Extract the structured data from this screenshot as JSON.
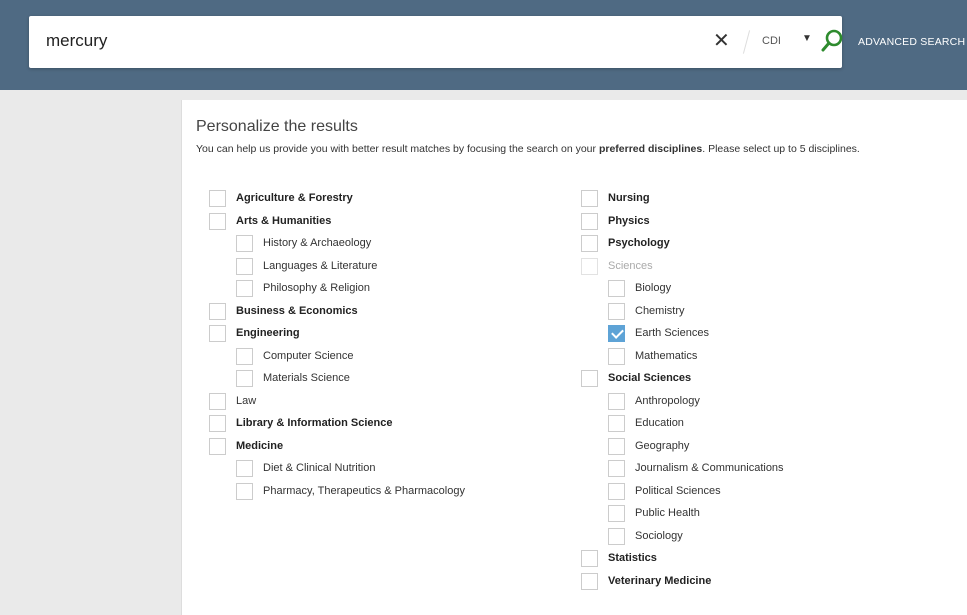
{
  "search": {
    "query": "mercury",
    "scope": "CDI",
    "advanced_label": "ADVANCED SEARCH"
  },
  "panel": {
    "title": "Personalize the results",
    "desc_before": "You can help us provide you with better result matches by focusing the search on your ",
    "desc_bold": "preferred disciplines",
    "desc_after": ". Please select up to 5 disciplines."
  },
  "left_disciplines": [
    {
      "label": "Agriculture & Forestry",
      "level": "parent",
      "checked": false
    },
    {
      "label": "Arts & Humanities",
      "level": "parent",
      "checked": false
    },
    {
      "label": "History & Archaeology",
      "level": "child",
      "checked": false
    },
    {
      "label": "Languages & Literature",
      "level": "child",
      "checked": false
    },
    {
      "label": "Philosophy & Religion",
      "level": "child",
      "checked": false
    },
    {
      "label": "Business & Economics",
      "level": "parent",
      "checked": false
    },
    {
      "label": "Engineering",
      "level": "parent",
      "checked": false
    },
    {
      "label": "Computer Science",
      "level": "child",
      "checked": false
    },
    {
      "label": "Materials Science",
      "level": "child",
      "checked": false
    },
    {
      "label": "Law",
      "level": "parent-plain",
      "checked": false
    },
    {
      "label": "Library & Information Science",
      "level": "parent",
      "checked": false
    },
    {
      "label": "Medicine",
      "level": "parent",
      "checked": false
    },
    {
      "label": "Diet & Clinical Nutrition",
      "level": "child",
      "checked": false
    },
    {
      "label": "Pharmacy, Therapeutics & Pharmacology",
      "level": "child",
      "checked": false
    }
  ],
  "right_disciplines": [
    {
      "label": "Nursing",
      "level": "parent",
      "checked": false
    },
    {
      "label": "Physics",
      "level": "parent",
      "checked": false
    },
    {
      "label": "Psychology",
      "level": "parent",
      "checked": false
    },
    {
      "label": "Sciences",
      "level": "disabled",
      "checked": false
    },
    {
      "label": "Biology",
      "level": "child",
      "checked": false
    },
    {
      "label": "Chemistry",
      "level": "child",
      "checked": false
    },
    {
      "label": "Earth Sciences",
      "level": "child",
      "checked": true
    },
    {
      "label": "Mathematics",
      "level": "child",
      "checked": false
    },
    {
      "label": "Social Sciences",
      "level": "parent",
      "checked": false
    },
    {
      "label": "Anthropology",
      "level": "child",
      "checked": false
    },
    {
      "label": "Education",
      "level": "child",
      "checked": false
    },
    {
      "label": "Geography",
      "level": "child",
      "checked": false
    },
    {
      "label": "Journalism & Communications",
      "level": "child",
      "checked": false
    },
    {
      "label": "Political Sciences",
      "level": "child",
      "checked": false
    },
    {
      "label": "Public Health",
      "level": "child",
      "checked": false
    },
    {
      "label": "Sociology",
      "level": "child",
      "checked": false
    },
    {
      "label": "Statistics",
      "level": "parent",
      "checked": false
    },
    {
      "label": "Veterinary Medicine",
      "level": "parent",
      "checked": false
    }
  ],
  "icons": {
    "clear": "close-icon",
    "dropdown": "caret-down-icon",
    "search": "search-icon"
  },
  "colors": {
    "header": "#4f6a83",
    "checked": "#5ea3d6",
    "search_icon": "#2e8b2e"
  }
}
